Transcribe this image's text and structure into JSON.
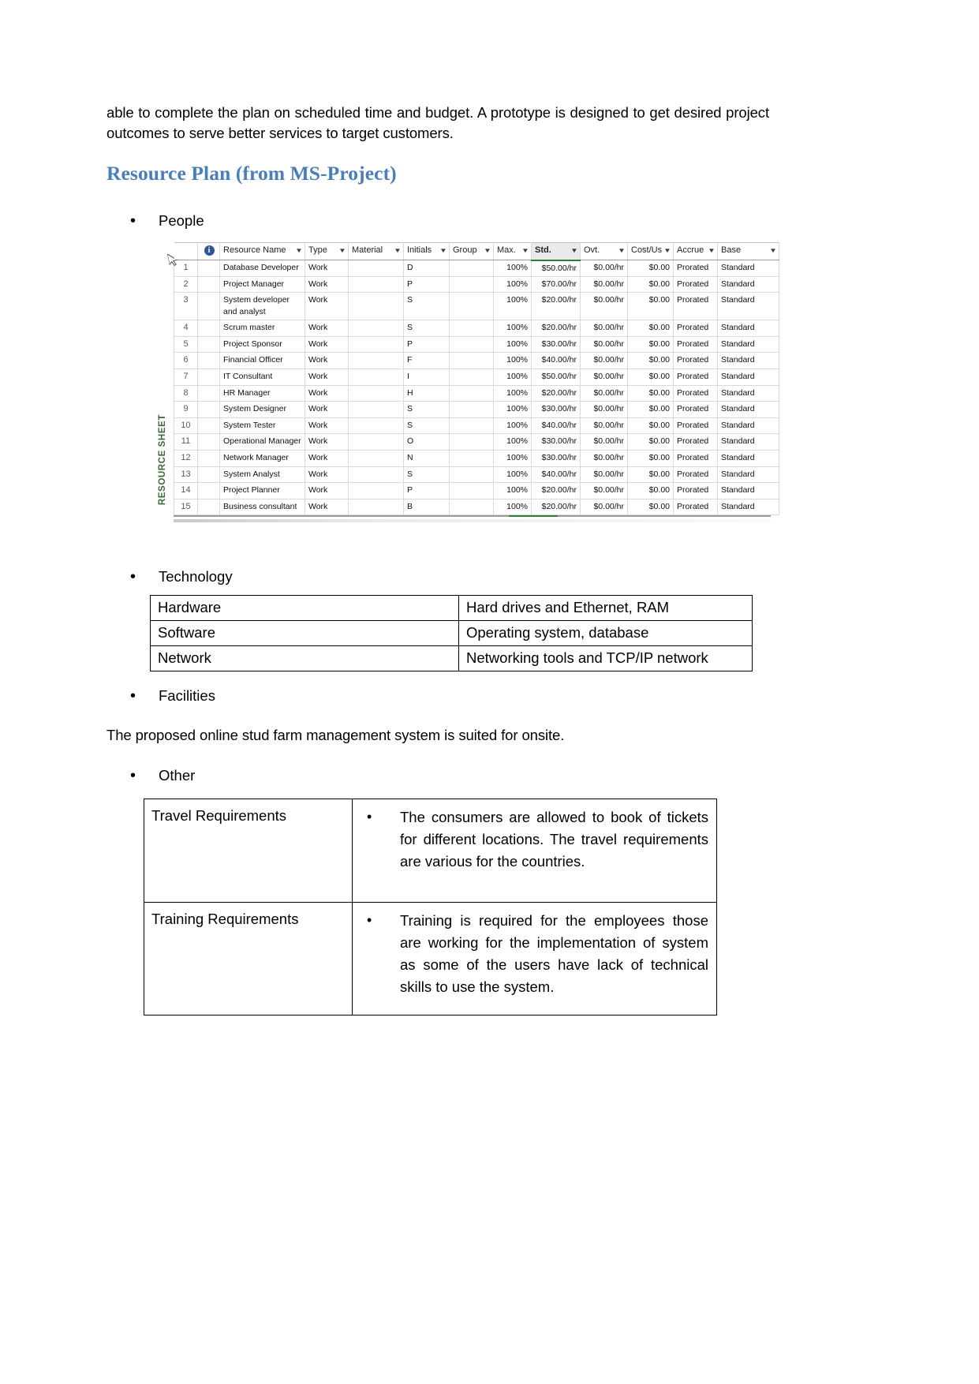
{
  "document": {
    "intro_paragraph": "able to complete the plan on scheduled time and budget. A prototype is designed to get desired project outcomes to serve better services to target customers.",
    "heading": "Resource Plan (from MS-Project)",
    "bullets": {
      "people": "People",
      "technology": "Technology",
      "facilities": "Facilities",
      "other": "Other"
    },
    "facilities_text": "The proposed online stud farm management system is suited for onsite.",
    "bullet_glyph": "•"
  },
  "resource_sheet": {
    "side_label": "RESOURCE SHEET",
    "info_glyph": "i",
    "filter_glyph": "▼",
    "columns": [
      {
        "key": "row",
        "label": ""
      },
      {
        "key": "indicator",
        "label": ""
      },
      {
        "key": "name",
        "label": "Resource Name"
      },
      {
        "key": "type",
        "label": "Type"
      },
      {
        "key": "material",
        "label": "Material"
      },
      {
        "key": "initials",
        "label": "Initials"
      },
      {
        "key": "group",
        "label": "Group"
      },
      {
        "key": "max",
        "label": "Max."
      },
      {
        "key": "std",
        "label": "Std."
      },
      {
        "key": "ovt",
        "label": "Ovt."
      },
      {
        "key": "costuse",
        "label": "Cost/Use"
      },
      {
        "key": "accrue",
        "label": "Accrue"
      },
      {
        "key": "base",
        "label": "Base"
      }
    ],
    "rows": [
      {
        "row": "1",
        "name": "Database Developer",
        "type": "Work",
        "material": "",
        "initials": "D",
        "group": "",
        "max": "100%",
        "std": "$50.00/hr",
        "ovt": "$0.00/hr",
        "costuse": "$0.00",
        "accrue": "Prorated",
        "base": "Standard"
      },
      {
        "row": "2",
        "name": "Project Manager",
        "type": "Work",
        "material": "",
        "initials": "P",
        "group": "",
        "max": "100%",
        "std": "$70.00/hr",
        "ovt": "$0.00/hr",
        "costuse": "$0.00",
        "accrue": "Prorated",
        "base": "Standard"
      },
      {
        "row": "3",
        "name": "System developer and analyst",
        "type": "Work",
        "material": "",
        "initials": "S",
        "group": "",
        "max": "100%",
        "std": "$20.00/hr",
        "ovt": "$0.00/hr",
        "costuse": "$0.00",
        "accrue": "Prorated",
        "base": "Standard"
      },
      {
        "row": "4",
        "name": "Scrum master",
        "type": "Work",
        "material": "",
        "initials": "S",
        "group": "",
        "max": "100%",
        "std": "$20.00/hr",
        "ovt": "$0.00/hr",
        "costuse": "$0.00",
        "accrue": "Prorated",
        "base": "Standard"
      },
      {
        "row": "5",
        "name": "Project Sponsor",
        "type": "Work",
        "material": "",
        "initials": "P",
        "group": "",
        "max": "100%",
        "std": "$30.00/hr",
        "ovt": "$0.00/hr",
        "costuse": "$0.00",
        "accrue": "Prorated",
        "base": "Standard"
      },
      {
        "row": "6",
        "name": "Financial Officer",
        "type": "Work",
        "material": "",
        "initials": "F",
        "group": "",
        "max": "100%",
        "std": "$40.00/hr",
        "ovt": "$0.00/hr",
        "costuse": "$0.00",
        "accrue": "Prorated",
        "base": "Standard"
      },
      {
        "row": "7",
        "name": "IT Consultant",
        "type": "Work",
        "material": "",
        "initials": "I",
        "group": "",
        "max": "100%",
        "std": "$50.00/hr",
        "ovt": "$0.00/hr",
        "costuse": "$0.00",
        "accrue": "Prorated",
        "base": "Standard"
      },
      {
        "row": "8",
        "name": "HR Manager",
        "type": "Work",
        "material": "",
        "initials": "H",
        "group": "",
        "max": "100%",
        "std": "$20.00/hr",
        "ovt": "$0.00/hr",
        "costuse": "$0.00",
        "accrue": "Prorated",
        "base": "Standard"
      },
      {
        "row": "9",
        "name": "System Designer",
        "type": "Work",
        "material": "",
        "initials": "S",
        "group": "",
        "max": "100%",
        "std": "$30.00/hr",
        "ovt": "$0.00/hr",
        "costuse": "$0.00",
        "accrue": "Prorated",
        "base": "Standard"
      },
      {
        "row": "10",
        "name": "System Tester",
        "type": "Work",
        "material": "",
        "initials": "S",
        "group": "",
        "max": "100%",
        "std": "$40.00/hr",
        "ovt": "$0.00/hr",
        "costuse": "$0.00",
        "accrue": "Prorated",
        "base": "Standard"
      },
      {
        "row": "11",
        "name": "Operational Manager",
        "type": "Work",
        "material": "",
        "initials": "O",
        "group": "",
        "max": "100%",
        "std": "$30.00/hr",
        "ovt": "$0.00/hr",
        "costuse": "$0.00",
        "accrue": "Prorated",
        "base": "Standard"
      },
      {
        "row": "12",
        "name": "Network Manager",
        "type": "Work",
        "material": "",
        "initials": "N",
        "group": "",
        "max": "100%",
        "std": "$30.00/hr",
        "ovt": "$0.00/hr",
        "costuse": "$0.00",
        "accrue": "Prorated",
        "base": "Standard"
      },
      {
        "row": "13",
        "name": "System Analyst",
        "type": "Work",
        "material": "",
        "initials": "S",
        "group": "",
        "max": "100%",
        "std": "$40.00/hr",
        "ovt": "$0.00/hr",
        "costuse": "$0.00",
        "accrue": "Prorated",
        "base": "Standard"
      },
      {
        "row": "14",
        "name": "Project Planner",
        "type": "Work",
        "material": "",
        "initials": "P",
        "group": "",
        "max": "100%",
        "std": "$20.00/hr",
        "ovt": "$0.00/hr",
        "costuse": "$0.00",
        "accrue": "Prorated",
        "base": "Standard"
      },
      {
        "row": "15",
        "name": "Business consultant",
        "type": "Work",
        "material": "",
        "initials": "B",
        "group": "",
        "max": "100%",
        "std": "$20.00/hr",
        "ovt": "$0.00/hr",
        "costuse": "$0.00",
        "accrue": "Prorated",
        "base": "Standard"
      }
    ],
    "selected_column": "Std.",
    "accent_color": "#2e7d32"
  },
  "technology_table": {
    "rows": [
      {
        "label": "Hardware",
        "value": "Hard drives and Ethernet, RAM"
      },
      {
        "label": "Software",
        "value": "Operating system, database"
      },
      {
        "label": "Network",
        "value": "Networking tools and TCP/IP network"
      }
    ]
  },
  "other_table": {
    "rows": [
      {
        "label": "Travel Requirements",
        "value": "The consumers are allowed to book of tickets for different locations. The travel requirements are various for the countries."
      },
      {
        "label": "Training Requirements",
        "value": "Training is required for the employees those are working for the implementation of system as some of the users have lack of technical skills to use the system."
      }
    ]
  },
  "theme": {
    "heading_color": "#4a7ebb",
    "sheet_label_color": "#3b6b35"
  }
}
